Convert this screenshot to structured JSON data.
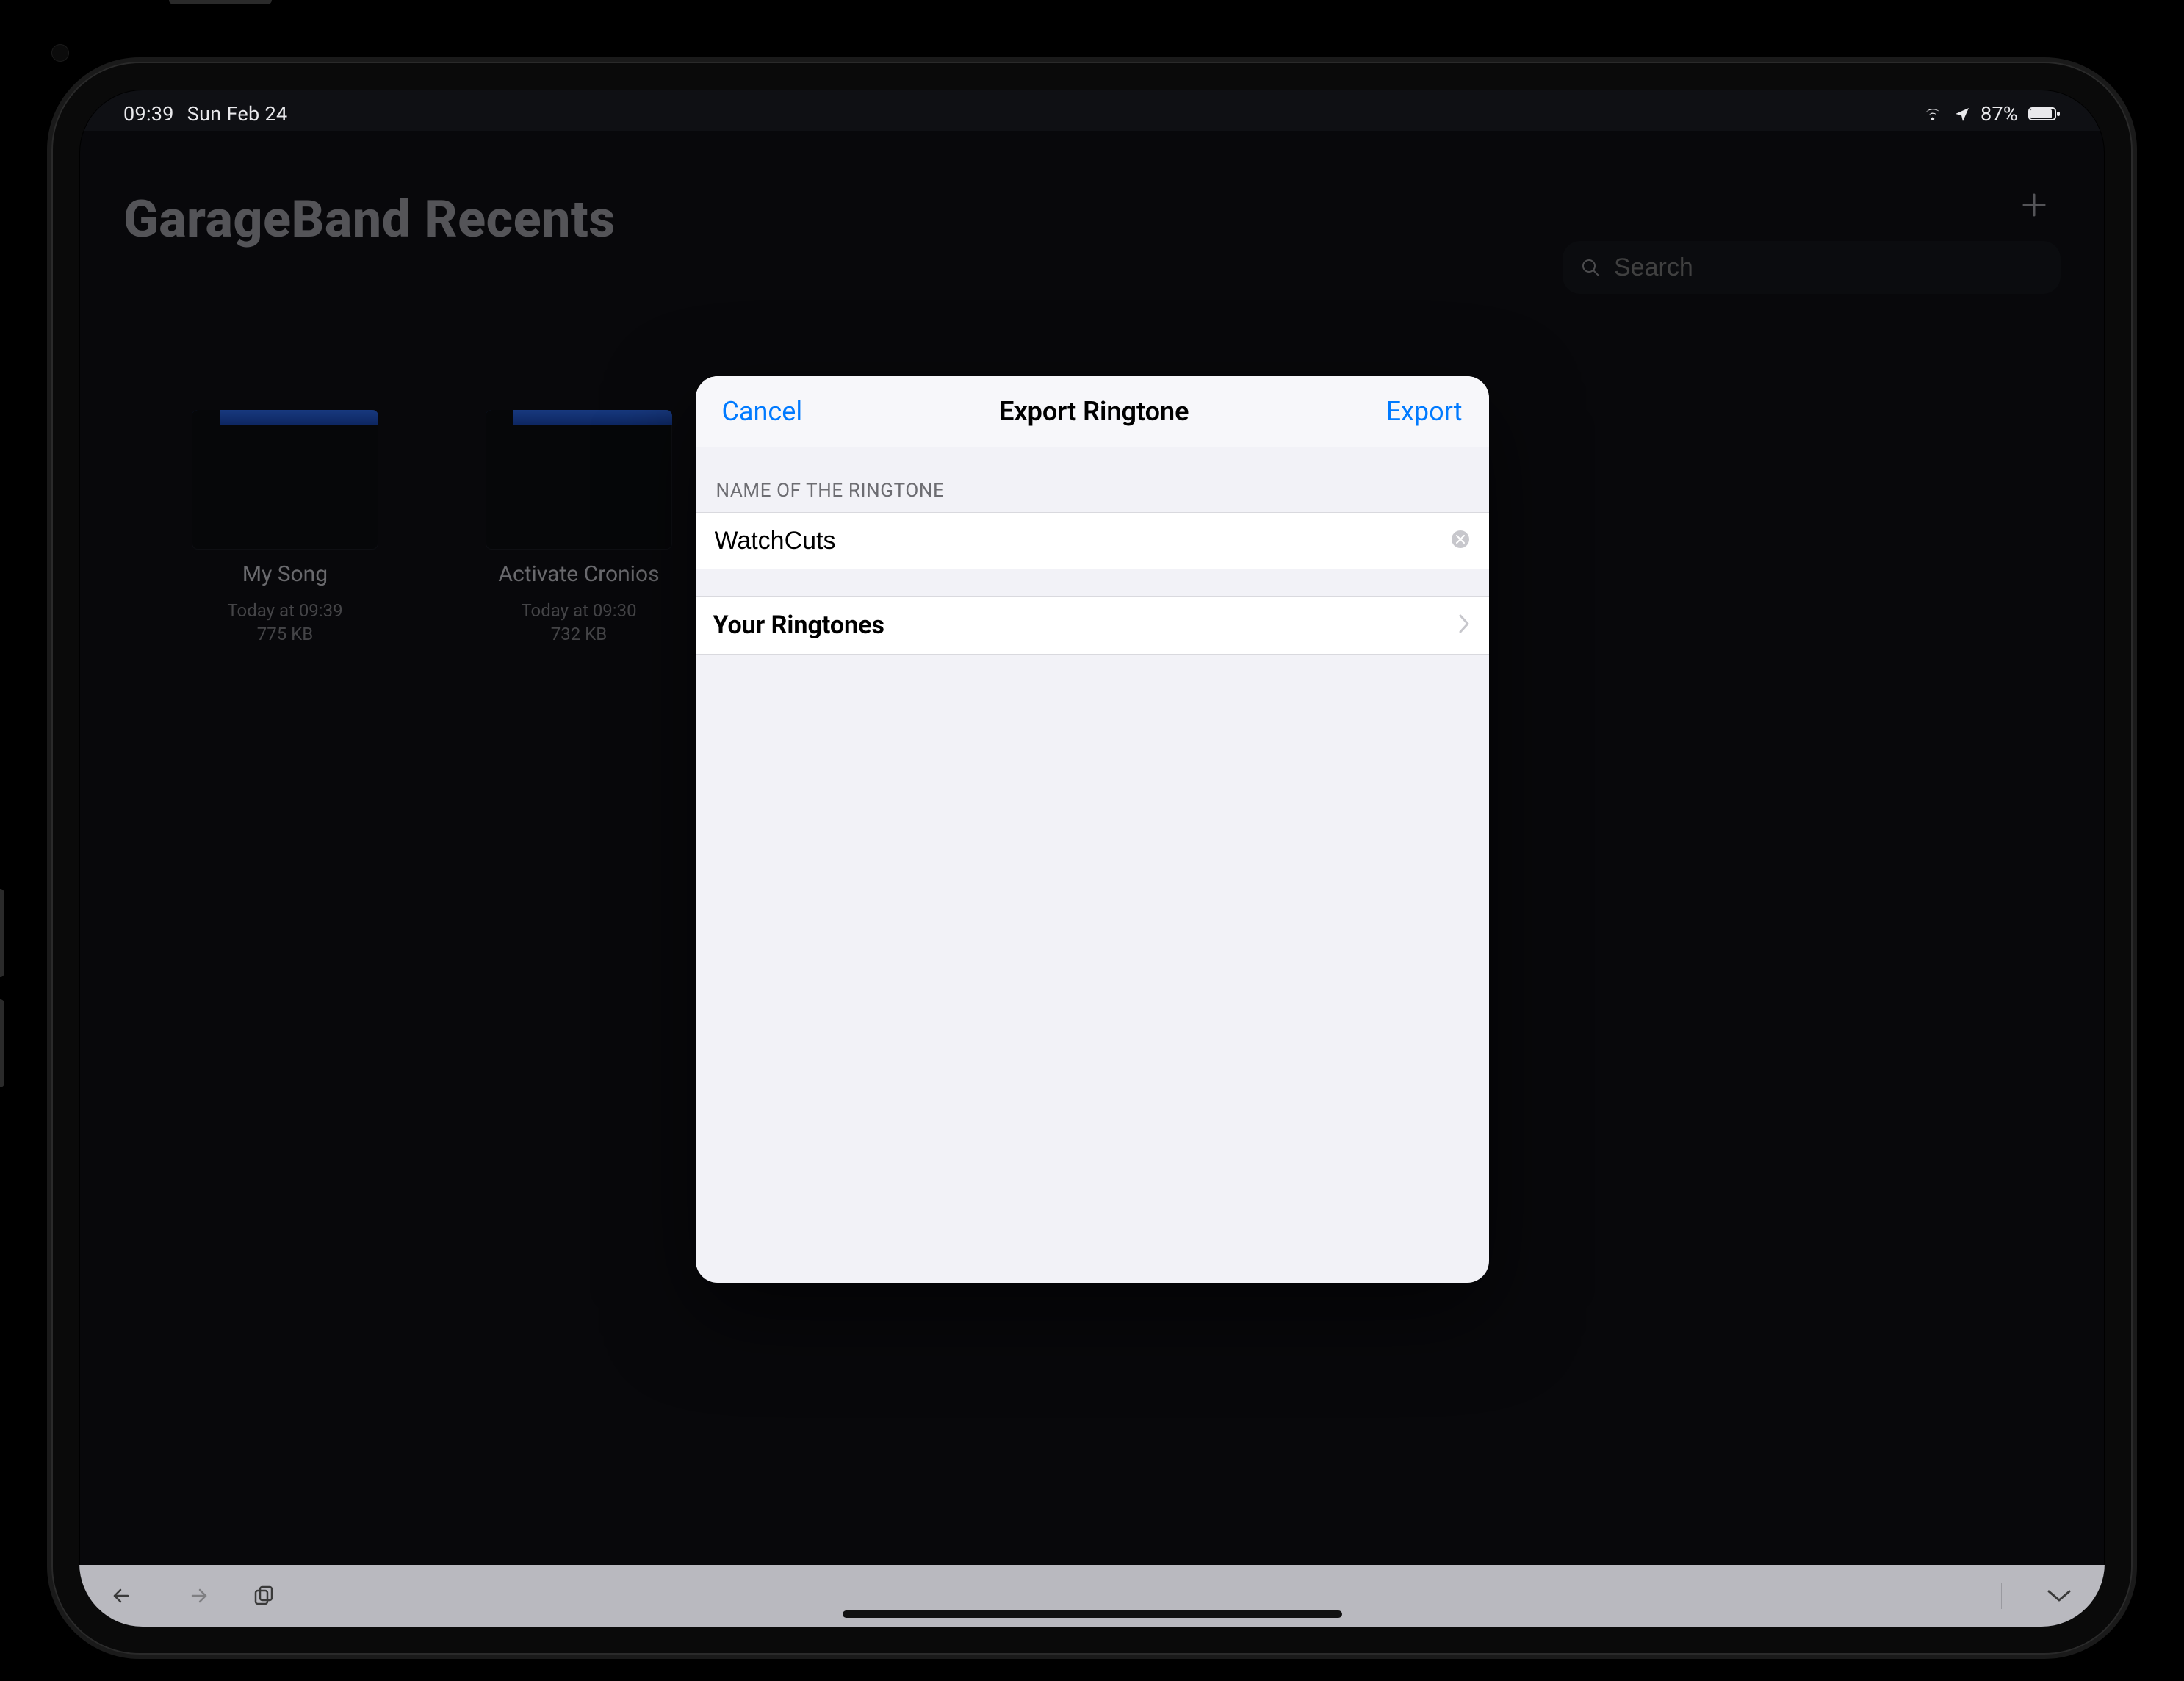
{
  "status": {
    "time": "09:39",
    "date": "Sun Feb 24",
    "battery": "87%"
  },
  "app": {
    "title": "GarageBand Recents",
    "search_placeholder": "Search"
  },
  "files": [
    {
      "name": "My Song",
      "time": "Today at 09:39",
      "size": "775 KB"
    },
    {
      "name": "Activate Cronios",
      "time": "Today at 09:30",
      "size": "732 KB"
    }
  ],
  "modal": {
    "cancel": "Cancel",
    "title": "Export Ringtone",
    "export": "Export",
    "section": "NAME OF THE RINGTONE",
    "value": "WatchCuts",
    "your_ringtones": "Your Ringtones"
  }
}
